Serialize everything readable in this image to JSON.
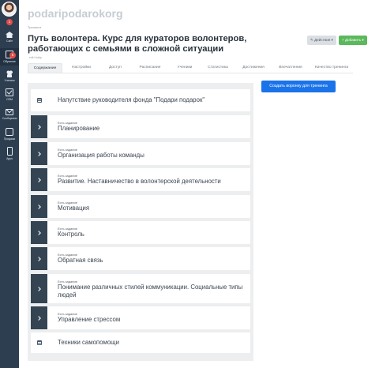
{
  "sidebar": {
    "items": [
      {
        "label": "Сайт",
        "icon": "home-icon",
        "badge": "1"
      },
      {
        "label": "Обучение",
        "icon": "education-icon",
        "badge": "5"
      },
      {
        "label": "Ученики",
        "icon": "users-icon"
      },
      {
        "label": "CRM",
        "icon": "crm-icon"
      },
      {
        "label": "Сообщения",
        "icon": "mail-icon"
      },
      {
        "label": "Продажи",
        "icon": "shop-icon"
      },
      {
        "label": "Apps",
        "icon": "phone-icon"
      }
    ]
  },
  "header": {
    "site_name": "podaripodarokorg",
    "breadcrumb": "Тренинги",
    "title": "Путь волонтера. Курс для кураторов волонтеров, работающих с семьями в сложной ситуации",
    "subcrumb": "edit Hololp",
    "actions_label": "✎ Действия ▾",
    "add_label": "+ Добавить ▾"
  },
  "tabs": [
    "Содержание",
    "Настройки",
    "Доступ",
    "Расписание",
    "Ученики",
    "Статистика",
    "Достижения",
    "Впечатления",
    "Качество тренинга"
  ],
  "funnel_button": "Создать воронку для тренинга",
  "lessons": [
    {
      "type": "plain",
      "title": "Напутствие руководителя фонда \"Подари подарок\""
    },
    {
      "type": "task",
      "task_label": "Есть задание",
      "title": "Планирование"
    },
    {
      "type": "task",
      "task_label": "Есть задание",
      "title": "Организация работы команды"
    },
    {
      "type": "task",
      "task_label": "Есть задание",
      "title": "Развитие. Наставничество в волонтерской деятельности"
    },
    {
      "type": "task",
      "task_label": "Есть задание",
      "title": "Мотивация"
    },
    {
      "type": "task",
      "task_label": "Есть задание",
      "title": "Контроль"
    },
    {
      "type": "task",
      "task_label": "Есть задание",
      "title": "Обратная связь"
    },
    {
      "type": "task",
      "task_label": "Есть задание",
      "title": "Понимание различных стилей коммуникации. Социальные типы людей"
    },
    {
      "type": "task",
      "task_label": "Есть задание",
      "title": "Управление стрессом"
    },
    {
      "type": "plain",
      "title": "Техники самопомощи"
    }
  ]
}
